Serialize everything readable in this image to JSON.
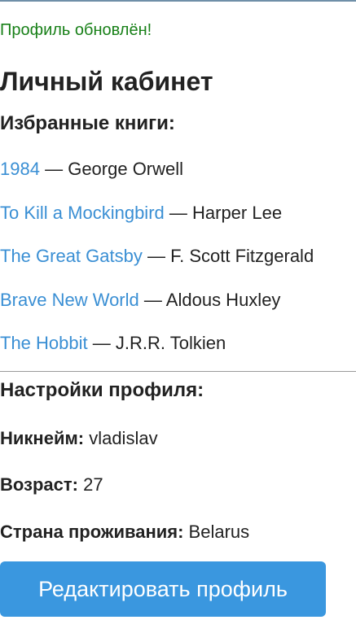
{
  "notice": "Профиль обновлён!",
  "page_title": "Личный кабинет",
  "favorites": {
    "title": "Избранные книги:",
    "separator": "—",
    "books": [
      {
        "title": "1984",
        "author": "George Orwell"
      },
      {
        "title": "To Kill a Mockingbird",
        "author": "Harper Lee"
      },
      {
        "title": "The Great Gatsby",
        "author": "F. Scott Fitzgerald"
      },
      {
        "title": "Brave New World",
        "author": "Aldous Huxley"
      },
      {
        "title": "The Hobbit",
        "author": "J.R.R. Tolkien"
      }
    ]
  },
  "settings": {
    "title": "Настройки профиля:",
    "nickname": {
      "label": "Никнейм:",
      "value": "vladislav"
    },
    "age": {
      "label": "Возраст:",
      "value": "27"
    },
    "country": {
      "label": "Страна проживания:",
      "value": "Belarus"
    }
  },
  "edit_button_label": "Редактировать профиль",
  "colors": {
    "notice": "#188018",
    "link": "#3a8fd4",
    "button": "#3a97df",
    "text": "#222222"
  }
}
